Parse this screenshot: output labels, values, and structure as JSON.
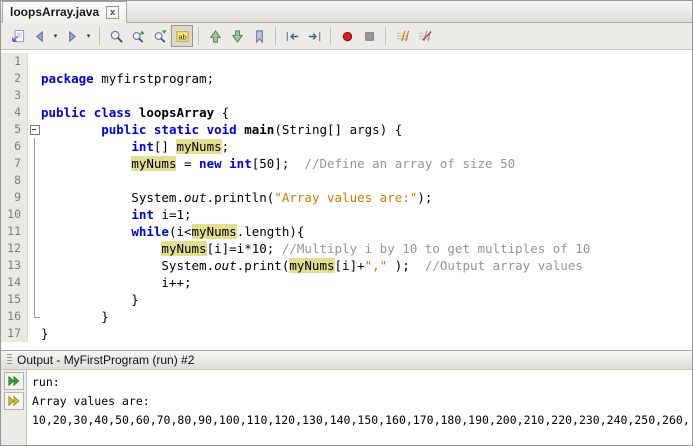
{
  "tab": {
    "label": "loopsArray.java",
    "close_glyph": "x"
  },
  "toolbar": {
    "groups": [
      [
        {
          "name": "last-edit-location"
        },
        {
          "name": "back",
          "dropdown": true
        },
        {
          "name": "forward",
          "dropdown": true
        }
      ],
      [
        {
          "name": "find-selection"
        },
        {
          "name": "find-previous-occurrence"
        },
        {
          "name": "find-next-occurrence"
        },
        {
          "name": "toggle-highlight-search",
          "pressed": true
        }
      ],
      [
        {
          "name": "previous-bookmark"
        },
        {
          "name": "next-bookmark"
        },
        {
          "name": "toggle-bookmark"
        }
      ],
      [
        {
          "name": "shift-line-left"
        },
        {
          "name": "shift-line-right"
        }
      ],
      [
        {
          "name": "start-macro-recording"
        },
        {
          "name": "stop-macro-recording"
        }
      ],
      [
        {
          "name": "comment"
        },
        {
          "name": "uncomment"
        }
      ]
    ]
  },
  "editor": {
    "lines": [
      {
        "num": 1,
        "seg": []
      },
      {
        "num": 2,
        "seg": [
          {
            "s": "kw",
            "t": "package"
          },
          {
            "s": "pl",
            "t": " myfirstprogram;"
          }
        ]
      },
      {
        "num": 3,
        "seg": []
      },
      {
        "num": 4,
        "seg": [
          {
            "s": "kw",
            "t": "public"
          },
          {
            "s": "pl",
            "t": " "
          },
          {
            "s": "kw",
            "t": "class"
          },
          {
            "s": "pl",
            "t": " "
          },
          {
            "s": "bd",
            "t": "loopsArray"
          },
          {
            "s": "pl",
            "t": " {"
          }
        ]
      },
      {
        "num": 5,
        "fold": "start",
        "seg": [
          {
            "s": "pl",
            "t": "        "
          },
          {
            "s": "kw",
            "t": "public"
          },
          {
            "s": "pl",
            "t": " "
          },
          {
            "s": "kw",
            "t": "static"
          },
          {
            "s": "pl",
            "t": " "
          },
          {
            "s": "kw",
            "t": "void"
          },
          {
            "s": "pl",
            "t": " "
          },
          {
            "s": "bd",
            "t": "main"
          },
          {
            "s": "pl",
            "t": "(String[] args) {"
          }
        ]
      },
      {
        "num": 6,
        "fold": "mid",
        "seg": [
          {
            "s": "pl",
            "t": "            "
          },
          {
            "s": "kw",
            "t": "int"
          },
          {
            "s": "pl",
            "t": "[] "
          },
          {
            "s": "hl",
            "t": "myNums"
          },
          {
            "s": "pl",
            "t": ";"
          }
        ]
      },
      {
        "num": 7,
        "fold": "mid",
        "seg": [
          {
            "s": "pl",
            "t": "            "
          },
          {
            "s": "hl",
            "t": "myNums"
          },
          {
            "s": "pl",
            "t": " = "
          },
          {
            "s": "kw",
            "t": "new"
          },
          {
            "s": "pl",
            "t": " "
          },
          {
            "s": "kw",
            "t": "int"
          },
          {
            "s": "pl",
            "t": "[50];  "
          },
          {
            "s": "com",
            "t": "//Define an array of size 50"
          }
        ]
      },
      {
        "num": 8,
        "fold": "mid",
        "seg": []
      },
      {
        "num": 9,
        "fold": "mid",
        "seg": [
          {
            "s": "pl",
            "t": "            System."
          },
          {
            "s": "fld",
            "t": "out"
          },
          {
            "s": "pl",
            "t": ".println("
          },
          {
            "s": "str",
            "t": "\"Array values are:\""
          },
          {
            "s": "pl",
            "t": ");"
          }
        ]
      },
      {
        "num": 10,
        "fold": "mid",
        "seg": [
          {
            "s": "pl",
            "t": "            "
          },
          {
            "s": "kw",
            "t": "int"
          },
          {
            "s": "pl",
            "t": " i=1;"
          }
        ]
      },
      {
        "num": 11,
        "fold": "mid",
        "seg": [
          {
            "s": "pl",
            "t": "            "
          },
          {
            "s": "kw",
            "t": "while"
          },
          {
            "s": "pl",
            "t": "(i<"
          },
          {
            "s": "hl",
            "t": "myNums"
          },
          {
            "s": "pl",
            "t": ".length){"
          }
        ]
      },
      {
        "num": 12,
        "fold": "mid",
        "seg": [
          {
            "s": "pl",
            "t": "                "
          },
          {
            "s": "hl",
            "t": "myNums"
          },
          {
            "s": "pl",
            "t": "[i]=i*10; "
          },
          {
            "s": "com",
            "t": "//Multiply i by 10 to get multiples of 10"
          }
        ]
      },
      {
        "num": 13,
        "fold": "mid",
        "seg": [
          {
            "s": "pl",
            "t": "                System."
          },
          {
            "s": "fld",
            "t": "out"
          },
          {
            "s": "pl",
            "t": ".print("
          },
          {
            "s": "hl",
            "t": "myNums"
          },
          {
            "s": "pl",
            "t": "[i]+"
          },
          {
            "s": "str",
            "t": "\",\""
          },
          {
            "s": "pl",
            "t": " );  "
          },
          {
            "s": "com",
            "t": "//Output array values"
          }
        ]
      },
      {
        "num": 14,
        "fold": "mid",
        "seg": [
          {
            "s": "pl",
            "t": "                i++;"
          }
        ]
      },
      {
        "num": 15,
        "fold": "mid",
        "seg": [
          {
            "s": "pl",
            "t": "            }"
          }
        ]
      },
      {
        "num": 16,
        "fold": "end",
        "seg": [
          {
            "s": "pl",
            "t": "        }"
          }
        ]
      },
      {
        "num": 17,
        "seg": [
          {
            "s": "pl",
            "t": "}"
          }
        ]
      }
    ]
  },
  "output": {
    "title": "Output - MyFirstProgram (run) #2",
    "toolbar": [
      {
        "name": "rerun"
      },
      {
        "name": "rerun-with-different-parameters"
      }
    ],
    "lines": [
      "run:",
      "Array values are:",
      "10,20,30,40,50,60,70,80,90,100,110,120,130,140,150,160,170,180,190,200,210,220,230,240,250,260,"
    ]
  },
  "colors": {
    "keyword_blue": "#0000e6",
    "string_orange": "#ce7b00",
    "comment_gray": "#969696",
    "occurrence_highlight": "#e3df90",
    "gutter_bg": "#e9e8e2",
    "record_red": "#cc2222",
    "rerun_green": "#3f9f3f",
    "rerun_yellow": "#c9c937"
  }
}
